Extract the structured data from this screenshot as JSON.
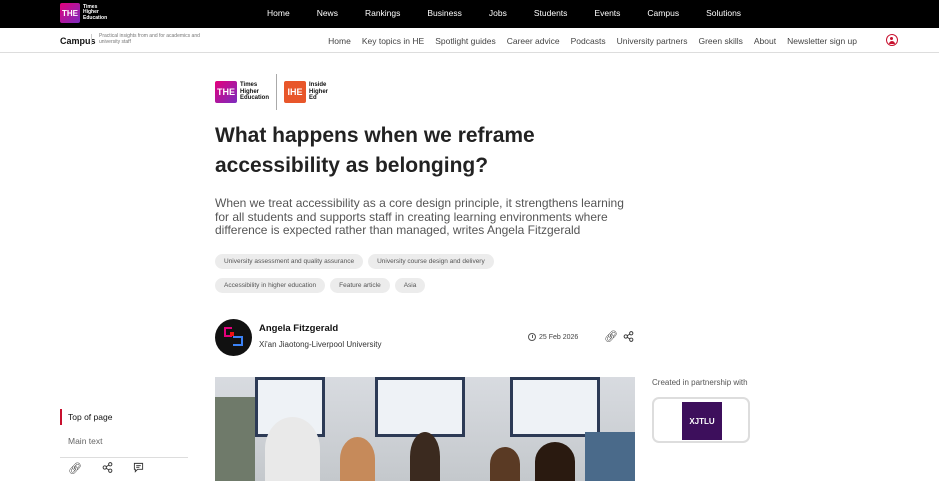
{
  "brand": {
    "logo_mark": "THE",
    "logo_text_line1": "Times",
    "logo_text_line2": "Higher",
    "logo_text_line3": "Education"
  },
  "top_nav": [
    "Home",
    "News",
    "Rankings",
    "Business",
    "Jobs",
    "Students",
    "Events",
    "Campus",
    "Solutions"
  ],
  "sub_header": {
    "section": "Campus",
    "tagline": "Practical insights from and for academics and university staff",
    "nav": [
      "Home",
      "Key topics in HE",
      "Spotlight guides",
      "Career advice",
      "Podcasts",
      "University partners",
      "Green skills",
      "About",
      "Newsletter sign up"
    ]
  },
  "partner_logos": {
    "the_mark": "THE",
    "the_text_1": "Times",
    "the_text_2": "Higher",
    "the_text_3": "Education",
    "ihe_mark": "IHE",
    "ihe_text_1": "Inside",
    "ihe_text_2": "Higher",
    "ihe_text_3": "Ed"
  },
  "article": {
    "title": "What happens when we reframe accessibility as belonging?",
    "standfirst": "When we treat accessibility as a core design principle, it strengthens learning for all students and supports staff in creating learning environments where difference is expected rather than managed, writes Angela Fitzgerald",
    "tags": [
      "University assessment and quality assurance",
      "University course design and delivery",
      "Accessibility in higher education",
      "Feature article",
      "Asia"
    ],
    "author_name": "Angela Fitzgerald",
    "author_affiliation": "Xi'an Jiaotong-Liverpool University",
    "date": "25 Feb 2026"
  },
  "sidebar_right": {
    "partnership_label": "Created in partnership with",
    "partner_logo_text": "XJTLU"
  },
  "toc": {
    "items": [
      "Top of page",
      "Main text"
    ]
  },
  "icons": {
    "link": "link-icon",
    "share": "share-icon",
    "comment": "comment-icon",
    "user": "user-icon",
    "clock": "clock-icon"
  },
  "colors": {
    "accent": "#c8102e",
    "brand_gradient_start": "#e4007c",
    "brand_gradient_end": "#7b2cbf",
    "ihe_orange": "#e8562a",
    "xjtlu_purple": "#3d0f5c"
  }
}
